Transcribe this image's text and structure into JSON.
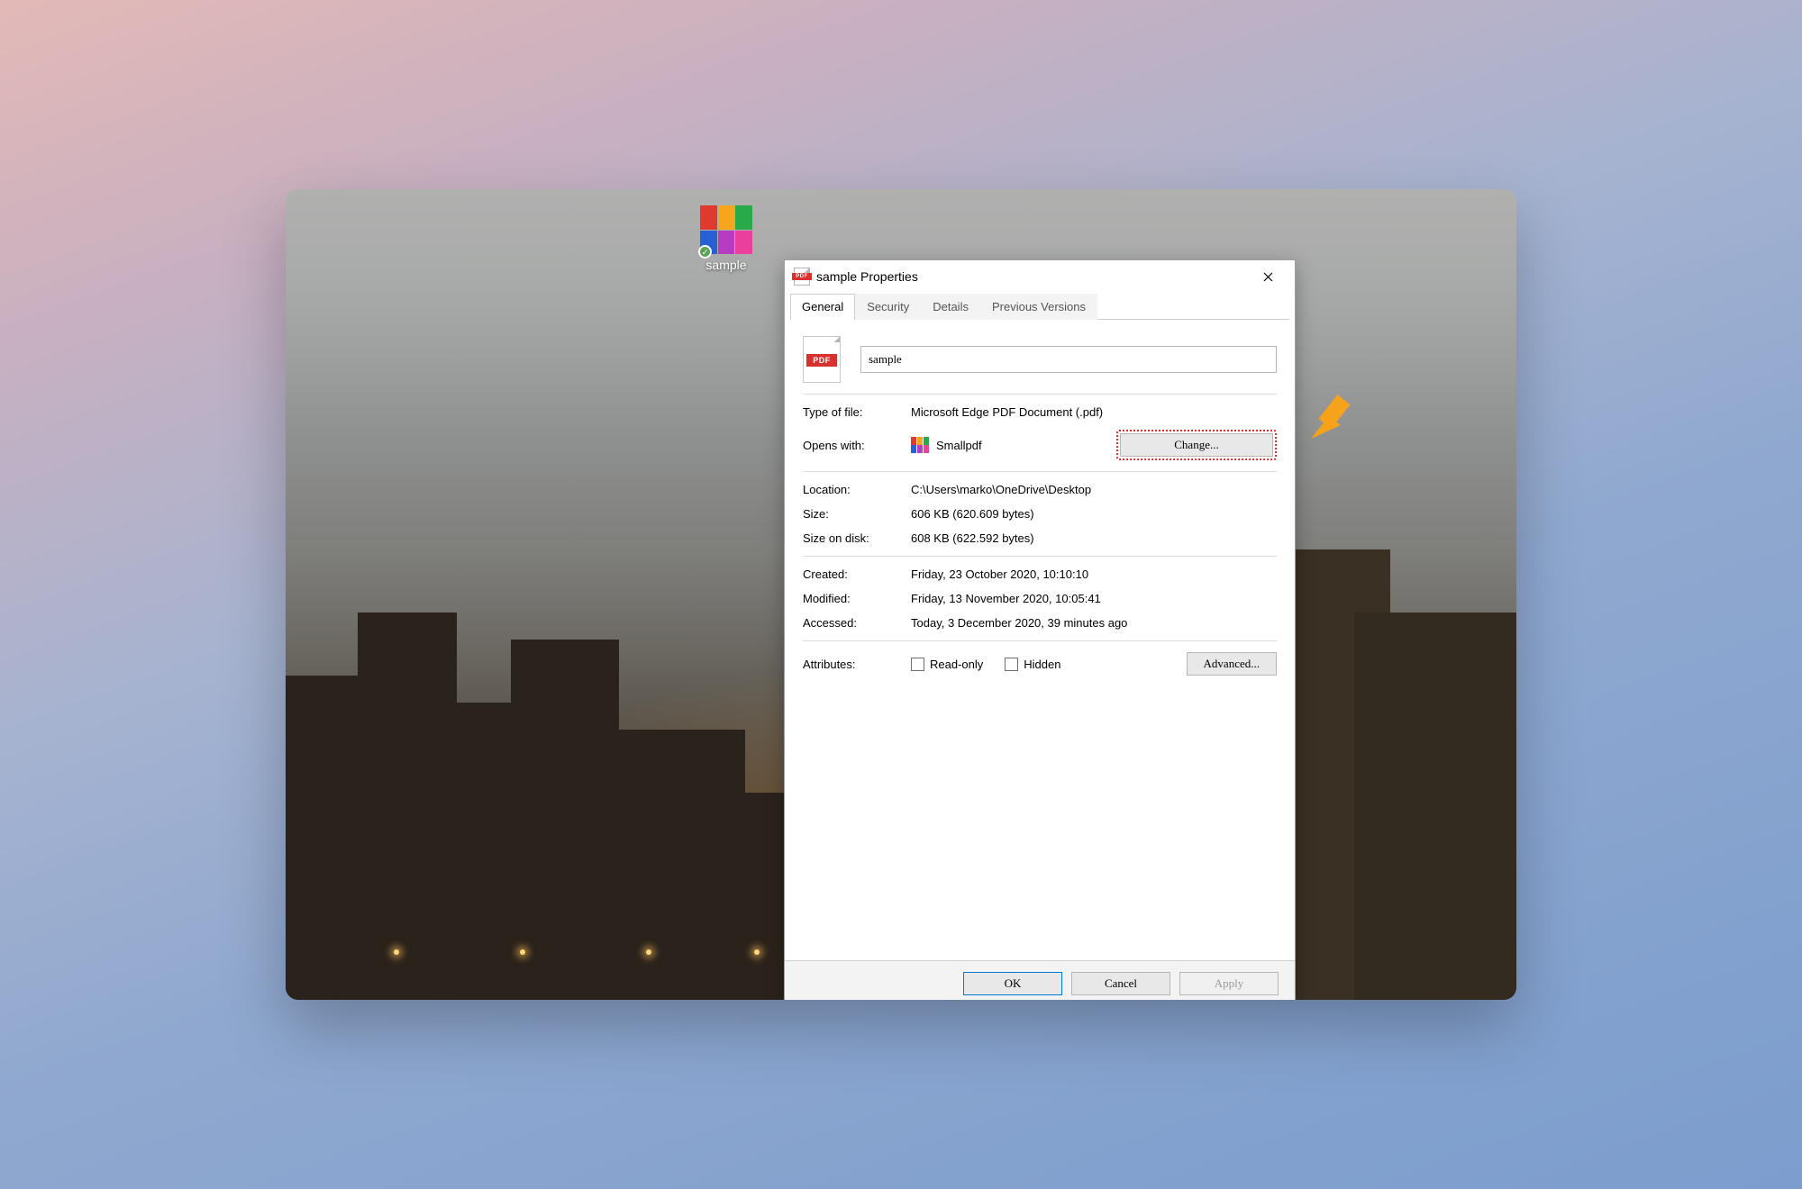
{
  "desktop": {
    "file_label": "sample"
  },
  "dialog": {
    "title": "sample Properties",
    "tabs": {
      "general": "General",
      "security": "Security",
      "details": "Details",
      "previous": "Previous Versions"
    },
    "filename": "sample",
    "labels": {
      "type": "Type of file:",
      "opens": "Opens with:",
      "location": "Location:",
      "size": "Size:",
      "disk": "Size on disk:",
      "created": "Created:",
      "modified": "Modified:",
      "accessed": "Accessed:",
      "attributes": "Attributes:"
    },
    "values": {
      "type": "Microsoft Edge PDF Document (.pdf)",
      "opens_app": "Smallpdf",
      "location": "C:\\Users\\marko\\OneDrive\\Desktop",
      "size": "606 KB (620.609 bytes)",
      "disk": "608 KB (622.592 bytes)",
      "created": "Friday, 23 October 2020, 10:10:10",
      "modified": "Friday, 13 November 2020, 10:05:41",
      "accessed": "Today, 3 December 2020, 39 minutes ago"
    },
    "attr": {
      "readonly": "Read-only",
      "hidden": "Hidden"
    },
    "buttons": {
      "change": "Change...",
      "advanced": "Advanced...",
      "ok": "OK",
      "cancel": "Cancel",
      "apply": "Apply"
    }
  },
  "colors": {
    "grid": [
      "#e03a2f",
      "#f7a51c",
      "#29aa4a",
      "#2760d4",
      "#b53dc1",
      "#ea3f9a"
    ]
  }
}
